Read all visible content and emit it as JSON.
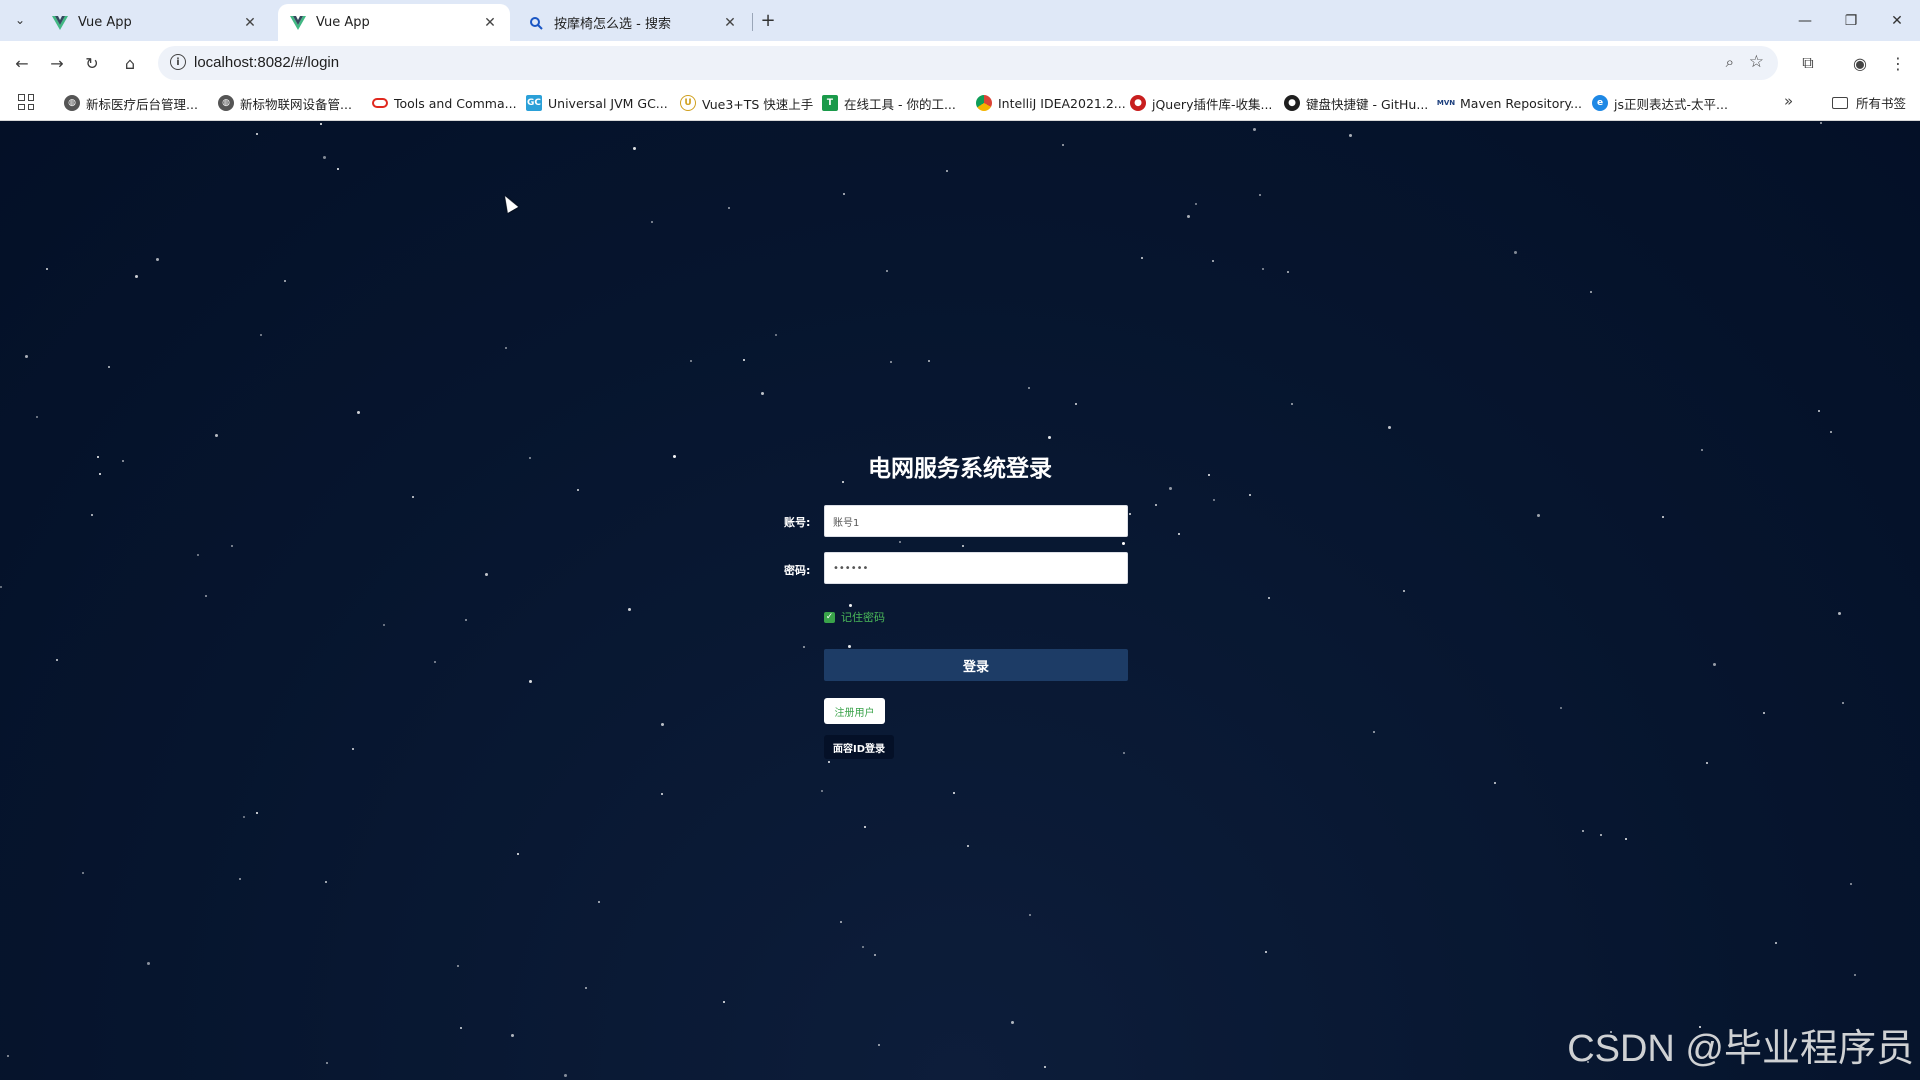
{
  "browser": {
    "tabs": [
      {
        "label": "Vue App",
        "icon": "vue-icon"
      },
      {
        "label": "Vue App",
        "icon": "vue-icon",
        "active": true
      },
      {
        "label": "按摩椅怎么选 - 搜索",
        "icon": "search-icon"
      }
    ],
    "url": "localhost:8082/#/login",
    "bookmarks": [
      {
        "label": "新标医疗后台管理...",
        "icon": "globe-icon"
      },
      {
        "label": "新标物联网设备管...",
        "icon": "globe-icon"
      },
      {
        "label": "Tools and Comma...",
        "icon": "oracle-icon"
      },
      {
        "label": "Universal JVM GC...",
        "icon": "gc-icon"
      },
      {
        "label": "Vue3+TS 快速上手",
        "icon": "vue-icon"
      },
      {
        "label": "在线工具 - 你的工...",
        "icon": "tool-icon"
      },
      {
        "label": "IntelliJ IDEA2021.2...",
        "icon": "chrome-icon"
      },
      {
        "label": "jQuery插件库-收集...",
        "icon": "jquery-icon"
      },
      {
        "label": "键盘快捷键 - GitHu...",
        "icon": "github-icon"
      },
      {
        "label": "Maven Repository...",
        "icon": "maven-icon"
      },
      {
        "label": "js正则表达式-太平...",
        "icon": "edge-icon"
      }
    ],
    "all_bookmarks_label": "所有书签"
  },
  "login": {
    "title": "电网服务系统登录",
    "account_label": "账号:",
    "account_value": "账号1",
    "password_label": "密码:",
    "password_value": "••••••",
    "remember_label": "记住密码",
    "remember_checked": true,
    "login_button": "登录",
    "register_button": "注册用户",
    "faceid_button": "面容ID登录"
  },
  "watermark": "CSDN @毕业程序员",
  "colors": {
    "page_bg": "#06152e",
    "login_button": "#1d3c66",
    "accent_green": "#3aa34a"
  }
}
